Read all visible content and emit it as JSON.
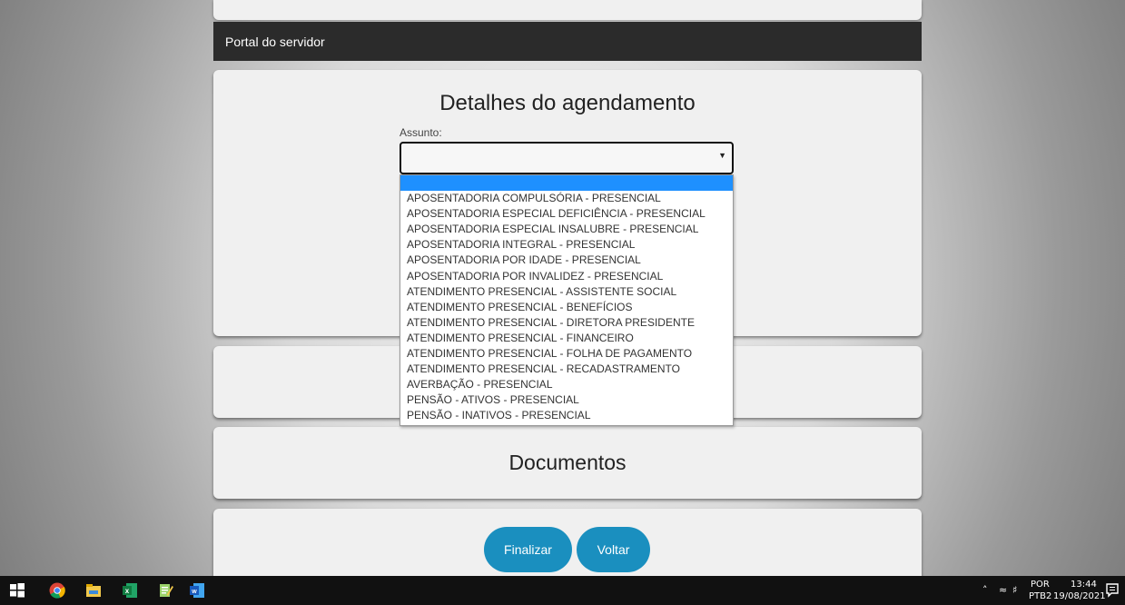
{
  "header": {
    "title": "Portal do servidor"
  },
  "details": {
    "title": "Detalhes do agendamento",
    "subject_label": "Assunto:",
    "subject_value": "",
    "options": [
      "",
      "APOSENTADORIA COMPULSÓRIA - PRESENCIAL",
      "APOSENTADORIA ESPECIAL DEFICIÊNCIA - PRESENCIAL",
      "APOSENTADORIA ESPECIAL INSALUBRE - PRESENCIAL",
      "APOSENTADORIA INTEGRAL - PRESENCIAL",
      "APOSENTADORIA POR IDADE - PRESENCIAL",
      "APOSENTADORIA POR INVALIDEZ - PRESENCIAL",
      "ATENDIMENTO PRESENCIAL - ASSISTENTE SOCIAL",
      "ATENDIMENTO PRESENCIAL - BENEFÍCIOS",
      "ATENDIMENTO PRESENCIAL - DIRETORA PRESIDENTE",
      "ATENDIMENTO PRESENCIAL - FINANCEIRO",
      "ATENDIMENTO PRESENCIAL - FOLHA DE PAGAMENTO",
      "ATENDIMENTO PRESENCIAL - RECADASTRAMENTO",
      "AVERBAÇÃO - PRESENCIAL",
      "PENSÃO - ATIVOS - PRESENCIAL",
      "PENSÃO - INATIVOS - PRESENCIAL"
    ]
  },
  "documents": {
    "title": "Documentos"
  },
  "actions": {
    "finalizar": "Finalizar",
    "voltar": "Voltar"
  },
  "taskbar": {
    "apps": [
      "windows-start-icon",
      "chrome-icon",
      "file-explorer-icon",
      "excel-icon",
      "notepad-icon",
      "word-icon"
    ],
    "tray": {
      "language": "POR",
      "keyboard": "PTB2",
      "time": "13:44",
      "date": "19/08/2021"
    }
  },
  "colors": {
    "accent": "#1a8fbf",
    "header_bg": "#2b2b2b",
    "selected_option": "#1e90ff"
  }
}
